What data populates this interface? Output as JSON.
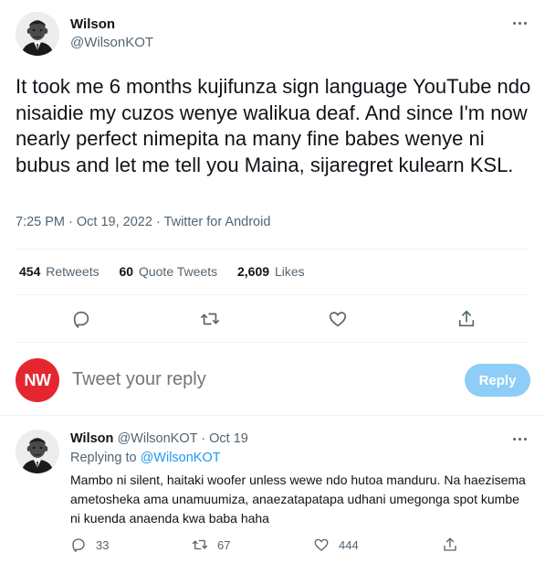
{
  "tweet": {
    "author_name": "Wilson",
    "author_handle": "@WilsonKOT",
    "text": "It took me 6 months kujifunza sign language YouTube ndo nisaidie my cuzos wenye walikua deaf. And since I'm now nearly perfect nimepita na many fine babes wenye ni bubus and let me tell you Maina, sijaregret kulearn KSL.",
    "time": "7:25 PM · Oct 19, 2022 · ",
    "source": "Twitter for Android",
    "stats": {
      "retweets_count": "454",
      "retweets_label": "Retweets",
      "quotes_count": "60",
      "quotes_label": "Quote Tweets",
      "likes_count": "2,609",
      "likes_label": "Likes"
    },
    "actions": [
      "reply-icon",
      "retweet-icon",
      "like-icon",
      "share-icon"
    ]
  },
  "compose": {
    "logo_text": "NW",
    "placeholder": "Tweet your reply",
    "button_label": "Reply",
    "button_color": "#8ecdf7",
    "logo_color": "#e3262f"
  },
  "reply": {
    "author_name": "Wilson",
    "author_handle": "@WilsonKOT",
    "date": "· Oct 19",
    "replying_prefix": "Replying to ",
    "replying_to": "@WilsonKOT",
    "text": "Mambo ni silent, haitaki woofer unless wewe ndo hutoa manduru. Na haezisema ametosheka ama unamuumiza, anaezatapatapa udhani umegonga spot kumbe ni kuenda anaenda kwa baba haha",
    "reply_count": "33",
    "retweet_count": "67",
    "like_count": "444"
  },
  "colors": {
    "accent": "#1d9bf0",
    "secondary_text": "#536471",
    "primary_text": "#0f1419"
  }
}
